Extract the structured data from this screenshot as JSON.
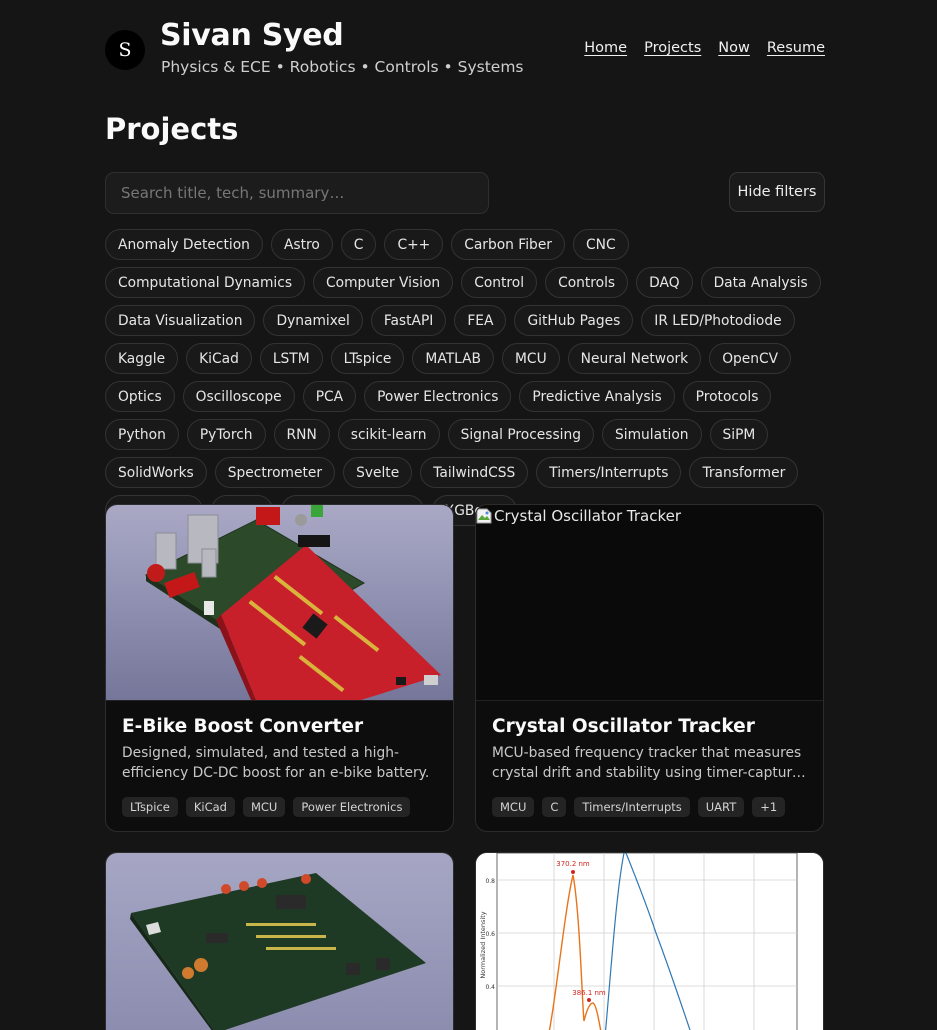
{
  "site": {
    "avatar_letter": "S",
    "name": "Sivan Syed",
    "subtitle": "Physics & ECE • Robotics • Controls • Systems"
  },
  "nav": [
    "Home",
    "Projects",
    "Now",
    "Resume"
  ],
  "page_title": "Projects",
  "search": {
    "placeholder": "Search title, tech, summary…",
    "value": ""
  },
  "filter_toggle_label": "Hide filters",
  "filters": [
    "Anomaly Detection",
    "Astro",
    "C",
    "C++",
    "Carbon Fiber",
    "CNC",
    "Computational Dynamics",
    "Computer Vision",
    "Control",
    "Controls",
    "DAQ",
    "Data Analysis",
    "Data Visualization",
    "Dynamixel",
    "FastAPI",
    "FEA",
    "GitHub Pages",
    "IR LED/Photodiode",
    "Kaggle",
    "KiCad",
    "LSTM",
    "LTspice",
    "MATLAB",
    "MCU",
    "Neural Network",
    "OpenCV",
    "Optics",
    "Oscilloscope",
    "PCA",
    "Power Electronics",
    "Predictive Analysis",
    "Protocols",
    "Python",
    "PyTorch",
    "RNN",
    "scikit-learn",
    "Signal Processing",
    "Simulation",
    "SiPM",
    "SolidWorks",
    "Spectrometer",
    "Svelte",
    "TailwindCSS",
    "Timers/Interrupts",
    "Transformer",
    "TypeScript",
    "UART",
    "Vehicle Modeling",
    "XGBoost"
  ],
  "projects": [
    {
      "title": "E-Bike Boost Converter",
      "summary": "Designed, simulated, and tested a high-efficiency DC-DC boost for an e-bike battery.",
      "tags": [
        "LTspice",
        "KiCad",
        "MCU",
        "Power Electronics"
      ],
      "image": "pcb-render"
    },
    {
      "title": "Crystal Oscillator Tracker",
      "summary": "MCU-based frequency tracker that measures crystal drift and stability using timer-capture and UART logging.",
      "tags": [
        "MCU",
        "C",
        "Timers/Interrupts",
        "UART",
        "+1"
      ],
      "image_alt": "Crystal Oscillator Tracker"
    },
    {
      "image": "green-pcb-render"
    },
    {
      "image": "spectrum-plot",
      "plot": {
        "ylabel": "Normalized Intensity",
        "peak_labels": [
          "370.2 nm",
          "386.1 nm"
        ],
        "yticks": [
          "0.8",
          "0.6",
          "0.4"
        ]
      }
    }
  ],
  "colors": {
    "background": "#151515",
    "card": "#0d0d0e",
    "chip_border": "#333333",
    "plot_orange": "#e8731a",
    "plot_blue": "#2f78b4",
    "plot_red": "#d0281e"
  }
}
